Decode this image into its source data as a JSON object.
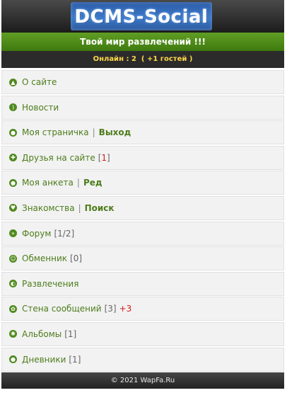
{
  "header": {
    "logo_text": "DCMS-Social"
  },
  "slogan": "Твой мир развлечений !!!",
  "online": {
    "label": "Онлайн : ",
    "count": "2",
    "guests": "( +1 гостей )"
  },
  "menu": [
    {
      "label": "О сайте",
      "icon": "arrow-up-icon"
    },
    {
      "label": "Новости",
      "icon": "rss-icon"
    },
    {
      "label": "Моя страничка",
      "icon": "user-icon",
      "extra": "Выход"
    },
    {
      "label": "Друзья на сайте",
      "icon": "friends-icon",
      "count_open": "[",
      "count": "1",
      "count_close": "]"
    },
    {
      "label": "Моя анкета",
      "icon": "profile-icon",
      "extra": "Ред"
    },
    {
      "label": "Знакомства",
      "icon": "heart-icon",
      "extra": "Поиск"
    },
    {
      "label": "Форум",
      "icon": "forum-icon",
      "count": "[1/2]"
    },
    {
      "label": "Обменник",
      "icon": "exchange-icon",
      "count": "[0]"
    },
    {
      "label": "Развлечения",
      "icon": "games-icon"
    },
    {
      "label": "Стена сообщений",
      "icon": "wall-icon",
      "count": "[3]",
      "plus": "+3"
    },
    {
      "label": "Альбомы",
      "icon": "albums-icon",
      "count": "[1]"
    },
    {
      "label": "Дневники",
      "icon": "diary-icon",
      "count": "[1]"
    }
  ],
  "footer": {
    "text": "© 2021 WapFa.Ru"
  },
  "colors": {
    "accent": "#4d7d1c",
    "header_bg": "#2b2b2b",
    "slogan_bg": "#5f9e24",
    "online_text": "#ffd84a",
    "alert": "#d21b1b"
  }
}
